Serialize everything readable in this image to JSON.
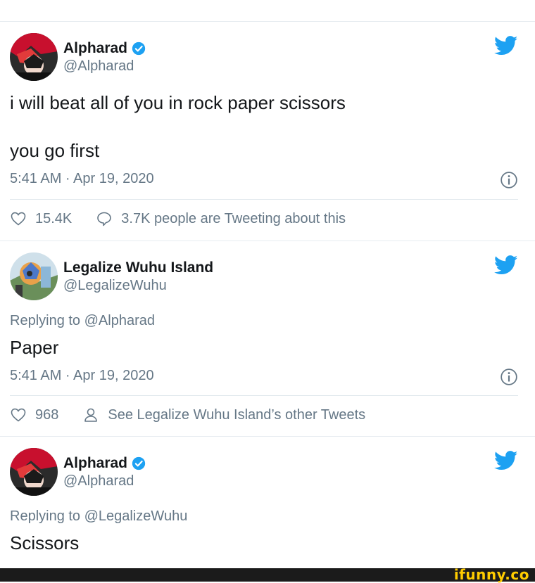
{
  "tweets": [
    {
      "name": "Alpharad",
      "handle": "@Alpharad",
      "verified": true,
      "text_lines": [
        "i will beat all of you in rock paper scissors",
        "you go first"
      ],
      "time": "5:41 AM · Apr 19, 2020",
      "likes": "15.4K",
      "secondary": "3.7K people are Tweeting about this",
      "secondary_icon": "speech-bubble-icon"
    },
    {
      "name": "Legalize Wuhu Island",
      "handle": "@LegalizeWuhu",
      "verified": false,
      "replying_prefix": "Replying to",
      "replying_to": "@Alpharad",
      "text": "Paper",
      "time": "5:41 AM · Apr 19, 2020",
      "likes": "968",
      "secondary": "See Legalize Wuhu Island’s other Tweets",
      "secondary_icon": "person-icon"
    },
    {
      "name": "Alpharad",
      "handle": "@Alpharad",
      "verified": true,
      "replying_prefix": "Replying to",
      "replying_to": "@LegalizeWuhu",
      "text": "Scissors"
    }
  ],
  "watermark": "ifunny.co",
  "colors": {
    "twitter_blue": "#1da1f2",
    "secondary_text": "#657786",
    "footer_bg": "#1b1b1b",
    "watermark": "#ffcc00"
  }
}
